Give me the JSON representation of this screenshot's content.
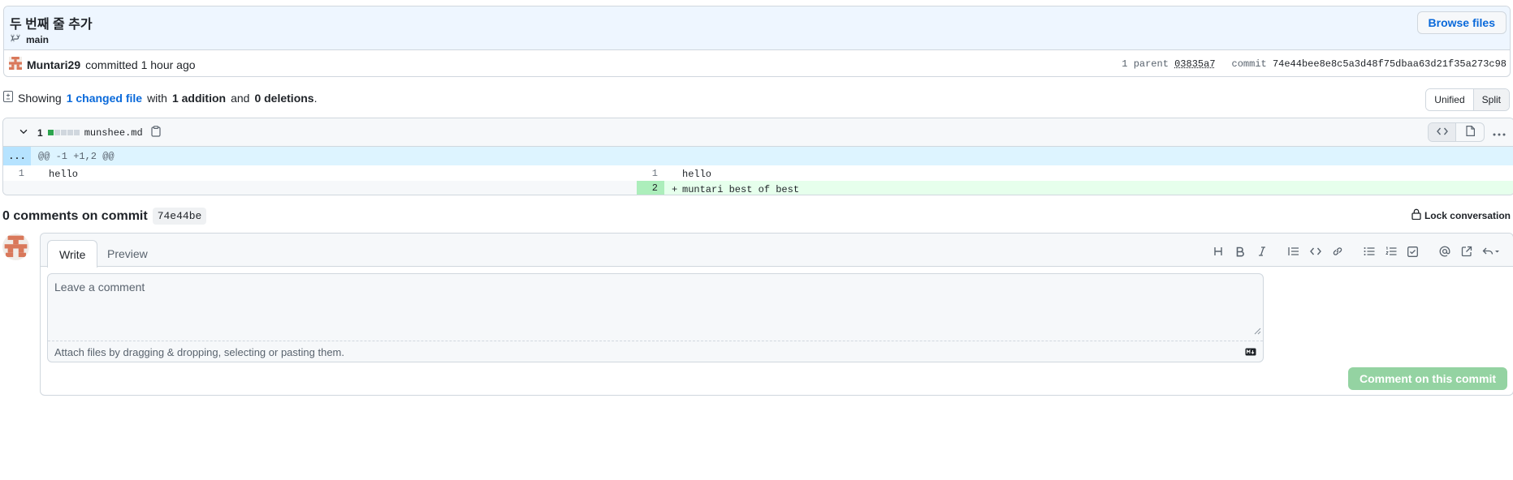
{
  "commit": {
    "title": "두 번째 줄 추가",
    "branch": "main",
    "browse_label": "Browse files",
    "author": "Muntari29",
    "action": "committed 1 hour ago",
    "parent_label": "1 parent",
    "parent_sha": "03835a7",
    "commit_label": "commit",
    "commit_sha": "74e44bee8e8c5a3d48f75dbaa63d21f35a273c98"
  },
  "summary": {
    "prefix": "Showing",
    "changed": "1 changed file",
    "with": "with",
    "additions": "1 addition",
    "and": "and",
    "deletions": "0 deletions",
    "period": ".",
    "unified_label": "Unified",
    "split_label": "Split"
  },
  "file": {
    "change_count": "1",
    "name": "munshee.md",
    "diffstat_added_boxes": 1,
    "diffstat_total_boxes": 5,
    "hunk_expander": "...",
    "hunk_header": "@@ -1 +1,2 @@",
    "left_lines": [
      {
        "num": "1",
        "text": "hello"
      }
    ],
    "right_lines": [
      {
        "num": "1",
        "text": "hello",
        "added": false
      },
      {
        "num": "2",
        "text": "muntari best of best",
        "added": true,
        "marker": "+"
      }
    ],
    "colors": {
      "addition_bg": "#e6ffec",
      "addition_num_bg": "#ccffd8"
    }
  },
  "comments": {
    "count_text": "0 comments on commit",
    "sha_short": "74e44be",
    "lock_label": "Lock conversation",
    "tab_write": "Write",
    "tab_preview": "Preview",
    "placeholder": "Leave a comment",
    "attach_text": "Attach files by dragging & dropping, selecting or pasting them.",
    "submit_label": "Comment on this commit",
    "toolbar_icons": [
      "heading-icon",
      "bold-icon",
      "italic-icon",
      "quote-icon",
      "code-icon",
      "link-icon",
      "unordered-list-icon",
      "ordered-list-icon",
      "task-list-icon",
      "mention-icon",
      "cross-reference-icon",
      "saved-reply-icon"
    ]
  }
}
